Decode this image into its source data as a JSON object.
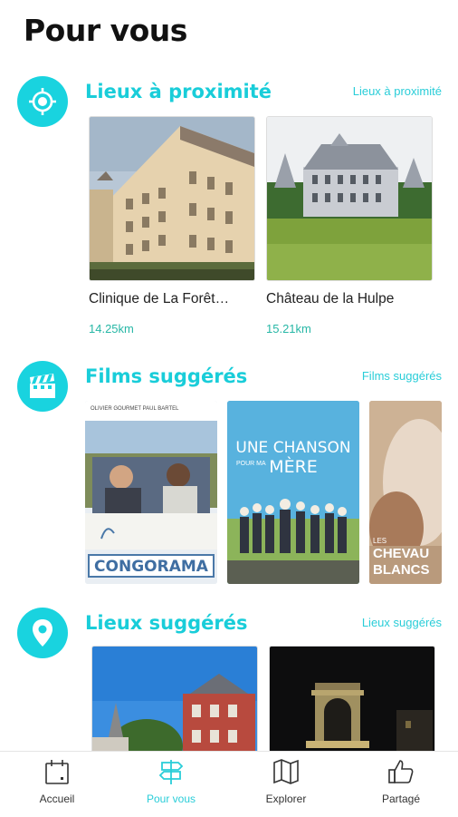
{
  "header": {
    "title": "Pour vous"
  },
  "nearby": {
    "title": "Lieux à proximité",
    "link": "Lieux à proximité",
    "icon": "target-icon",
    "items": [
      {
        "title": "Clinique de La Forêt…",
        "distance": "14.25km"
      },
      {
        "title": "Château de la Hulpe",
        "distance": "15.21km"
      }
    ]
  },
  "films": {
    "title": "Films suggérés",
    "link": "Films suggérés",
    "icon": "clapperboard-icon",
    "posters": [
      {
        "top_text": "OLIVIER GOURMET   PAUL BARTEL",
        "title": "CONGORAMA"
      },
      {
        "title_line1": "UNE CHANSON",
        "title_line2": "POUR MA",
        "title_line3": "MÈRE"
      },
      {
        "title_line1": "LES",
        "title_line2": "CHEVAU",
        "title_line3": "BLANCS"
      }
    ]
  },
  "places": {
    "title": "Lieux suggérés",
    "link": "Lieux suggérés",
    "icon": "map-pin-icon"
  },
  "tabbar": {
    "items": [
      {
        "label": "Accueil",
        "icon": "calendar-icon"
      },
      {
        "label": "Pour vous",
        "icon": "signpost-icon",
        "active": true
      },
      {
        "label": "Explorer",
        "icon": "map-icon"
      },
      {
        "label": "Partagé",
        "icon": "thumbs-up-icon"
      }
    ]
  },
  "colors": {
    "accent": "#19d3df",
    "distance": "#27b7a6"
  }
}
